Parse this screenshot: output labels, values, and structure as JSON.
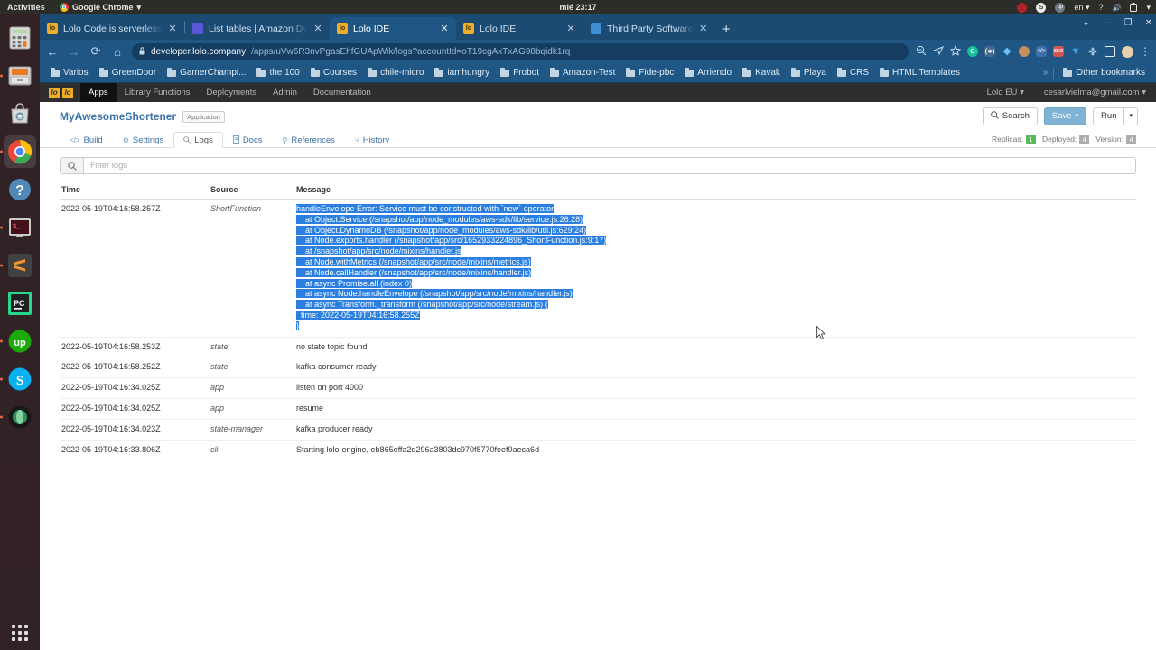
{
  "desktop": {
    "activities": "Activities",
    "active_app": "Google Chrome",
    "active_app_caret": "▾",
    "clock": "mié 23:17",
    "tray": {
      "record_icon": "record-indicator",
      "skype_label": "S",
      "upwork_label": "up",
      "language": "en",
      "caret": "▾",
      "help_icon": "?",
      "volume_icon": "🔊",
      "battery_icon": "battery-icon"
    },
    "dock": [
      {
        "name": "calculator",
        "label": "",
        "active": false
      },
      {
        "name": "files",
        "label": "",
        "active": false
      },
      {
        "name": "ubuntu-software",
        "label": "",
        "active": false
      },
      {
        "name": "google-chrome",
        "label": "",
        "active": true
      },
      {
        "name": "help",
        "label": "?",
        "active": false
      },
      {
        "name": "terminal",
        "label": "",
        "active": false
      },
      {
        "name": "sublime-text",
        "label": "S",
        "active": false
      },
      {
        "name": "pycharm",
        "label": "PC",
        "active": false
      },
      {
        "name": "upwork",
        "label": "up",
        "active": false
      },
      {
        "name": "skype",
        "label": "S",
        "active": false
      },
      {
        "name": "opera",
        "label": "",
        "active": false
      }
    ],
    "show_apps": "show-applications"
  },
  "browser": {
    "tabs": [
      {
        "title": "Lolo Code is serverless, ev",
        "favicon_label": "lo",
        "favicon_color": "#f0ad28",
        "active": false,
        "close": "✕"
      },
      {
        "title": "List tables | Amazon Dyna",
        "favicon_label": "",
        "favicon_color": "#5a57d6",
        "active": false,
        "close": "✕"
      },
      {
        "title": "Lolo IDE",
        "favicon_label": "lo",
        "favicon_color": "#f0ad28",
        "active": true,
        "close": "✕"
      },
      {
        "title": "Lolo IDE",
        "favicon_label": "lo",
        "favicon_color": "#f0ad28",
        "active": false,
        "close": "✕"
      },
      {
        "title": "Third Party Software",
        "favicon_label": "",
        "favicon_color": "#3d8fd1",
        "active": false,
        "close": "✕"
      }
    ],
    "new_tab": "+",
    "window_controls": {
      "menu": "⌄",
      "minimize": "—",
      "maximize": "❐",
      "close": "✕"
    },
    "nav": {
      "back": "←",
      "forward": "→",
      "reload": "⟳",
      "home": "⌂"
    },
    "omnibox": {
      "lock": "🔒",
      "host": "developer.lolo.company",
      "path": "/apps/uVw6R3nvPgasEhfGUApWik/logs?accountId=oT19cgAxTxAG98bqidk1rq"
    },
    "toolbar_right": {
      "zoom_icon": "search-minus-icon",
      "share_icon": "share-icon",
      "bookmark_icon": "star-icon",
      "extensions": [
        {
          "name": "grammarly-extension",
          "label": "G",
          "color": "#15c39a"
        },
        {
          "name": "rss-extension",
          "label": "",
          "color": "#7a93a8"
        },
        {
          "name": "colorzilla-extension",
          "label": "",
          "color": "#4da3ff"
        },
        {
          "name": "wappalyzer-extension",
          "label": "",
          "color": "#c48f5a"
        },
        {
          "name": "code-extension",
          "label": "</>",
          "color": "#5c8fd6"
        },
        {
          "name": "seo-extension",
          "label": "",
          "color": "#e04a3f"
        },
        {
          "name": "vimeo-extension",
          "label": "▼",
          "color": "#3da0e3"
        },
        {
          "name": "puzzle-extension",
          "label": "🧩",
          "color": "#7ea6c9"
        },
        {
          "name": "window-extension",
          "label": "▫",
          "color": "#cfe0ef"
        }
      ],
      "avatar": "avatar",
      "menu": "⋮"
    },
    "bookmarks": [
      "Varios",
      "GreenDoor",
      "GamerChampi...",
      "the 100",
      "Courses",
      "chile-micro",
      "iamhungry",
      "Frobot",
      "Amazon-Test",
      "Fide-pbc",
      "Arriendo",
      "Kavak",
      "Playa",
      "CRS",
      "HTML Templates"
    ],
    "bookmarks_overflow": "»",
    "other_bookmarks": "Other bookmarks"
  },
  "app": {
    "brand_logo": "lo",
    "nav": [
      {
        "label": "Apps",
        "active": true
      },
      {
        "label": "Library Functions",
        "active": false
      },
      {
        "label": "Deployments",
        "active": false
      },
      {
        "label": "Admin",
        "active": false
      },
      {
        "label": "Documentation",
        "active": false
      }
    ],
    "region": "Lolo EU",
    "region_caret": "▾",
    "account": "cesarlvielma@gmail.com",
    "account_caret": "▾",
    "title": "MyAwesomeShortener",
    "type_badge": "Application",
    "actions": {
      "search": "Search",
      "search_icon": "search-icon",
      "save": "Save",
      "save_caret": "▾",
      "run": "Run",
      "run_caret": "▾"
    },
    "tabs": [
      {
        "label": "Build",
        "icon": "</>",
        "active": false
      },
      {
        "label": "Settings",
        "icon": "⚙",
        "active": false
      },
      {
        "label": "Logs",
        "icon": "🔍",
        "active": true
      },
      {
        "label": "Docs",
        "icon": "📄",
        "active": false
      },
      {
        "label": "References",
        "icon": "⚲",
        "active": false
      },
      {
        "label": "History",
        "icon": "⑂",
        "active": false
      }
    ],
    "meta": {
      "replicas_label": "Replicas:",
      "replicas_value": "1",
      "deployed_label": "Deployed:",
      "deployed_value": "4",
      "version_label": "Version:",
      "version_value": "4"
    },
    "filter": {
      "icon": "search-icon",
      "placeholder": "Filter logs",
      "value": ""
    },
    "table": {
      "columns": [
        "Time",
        "Source",
        "Message"
      ],
      "rows": [
        {
          "time": "2022-05-19T04:16:58.257Z",
          "source": "ShortFunction",
          "message_lines": [
            "handleEnvelope Error: Service must be constructed with `new` operator",
            "    at Object.Service (/snapshot/app/node_modules/aws-sdk/lib/service.js:26:28)",
            "    at Object.DynamoDB (/snapshot/app/node_modules/aws-sdk/lib/util.js:629:24)",
            "    at Node.exports.handler (/snapshot/app/src/1652933224896_ShortFunction.js:9:17)",
            "    at /snapshot/app/src/node/mixins/handler.js",
            "    at Node.withMetrics (/snapshot/app/src/node/mixins/metrics.js)",
            "    at Node.callHandler (/snapshot/app/src/node/mixins/handler.js)",
            "    at async Promise.all (index 0)",
            "    at async Node.handleEnvelope (/snapshot/app/src/node/mixins/handler.js)",
            "    at async Transform._transform (/snapshot/app/src/node/stream.js) {",
            "  time: 2022-05-19T04:16:58.255Z",
            "}"
          ],
          "selected": true
        },
        {
          "time": "2022-05-19T04:16:58.253Z",
          "source": "state",
          "message_lines": [
            "no state topic found"
          ],
          "selected": false
        },
        {
          "time": "2022-05-19T04:16:58.252Z",
          "source": "state",
          "message_lines": [
            "kafka consumer ready"
          ],
          "selected": false
        },
        {
          "time": "2022-05-19T04:16:34.025Z",
          "source": "app",
          "message_lines": [
            "listen on port 4000"
          ],
          "selected": false
        },
        {
          "time": "2022-05-19T04:16:34.025Z",
          "source": "app",
          "message_lines": [
            "resume"
          ],
          "selected": false
        },
        {
          "time": "2022-05-19T04:16:34.023Z",
          "source": "state-manager",
          "message_lines": [
            "kafka producer ready"
          ],
          "selected": false
        },
        {
          "time": "2022-05-19T04:16:33.806Z",
          "source": "cli",
          "message_lines": [
            "Starting lolo-engine, eb865effa2d296a3803dc970f8770feef0aeca6d"
          ],
          "selected": false
        }
      ]
    }
  },
  "colors": {
    "chrome_blue": "#1f5684",
    "chrome_dark": "#1b4a73",
    "selection": "#2a7fe0",
    "link": "#3b73a8",
    "brand_yellow": "#f0ad28"
  }
}
